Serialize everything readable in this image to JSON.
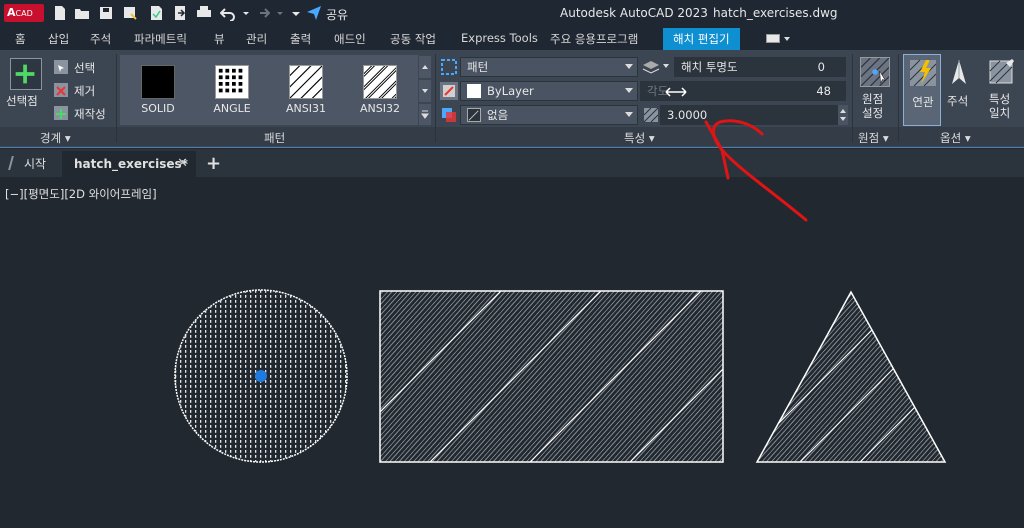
{
  "app": {
    "logo_main": "A",
    "logo_sub": "CAD",
    "share_label": "공유",
    "title": "Autodesk AutoCAD 2023",
    "filename": "hatch_exercises.dwg"
  },
  "tabs": [
    "홈",
    "삽입",
    "주석",
    "파라메트릭",
    "뷰",
    "관리",
    "출력",
    "애드인",
    "공동 작업",
    "Express Tools",
    "주요 응용프로그램",
    "해치 편집기"
  ],
  "ribbon": {
    "boundary": {
      "pick_points": "선택점",
      "select": "선택",
      "remove": "제거",
      "recreate": "재작성",
      "title": "경계 ▾"
    },
    "patterns": {
      "items": [
        "SOLID",
        "ANGLE",
        "ANSI31",
        "ANSI32"
      ],
      "title": "패턴"
    },
    "properties": {
      "type_value": "패턴",
      "color_value": "ByLayer",
      "background_value": "없음",
      "transparency_label": "해치 투명도",
      "transparency_value": "0",
      "angle_label": "각도",
      "angle_value": "48",
      "scale_value": "3.0000",
      "title": "특성 ▾"
    },
    "origin": {
      "set_origin": "원점\n설정",
      "title": "원점 ▾"
    },
    "options": {
      "associative": "연관",
      "annotative": "주석",
      "match": "특성\n일치",
      "title": "옵션 ▾"
    }
  },
  "doc_tabs": {
    "start": "시작",
    "active": "hatch_exercises*",
    "add": "+"
  },
  "viewport": {
    "label": "[−][평면도][2D 와이어프레임]"
  },
  "colors": {
    "accent": "#0e8fd1",
    "annotation": "#e01414",
    "grip": "#1e7be0"
  }
}
